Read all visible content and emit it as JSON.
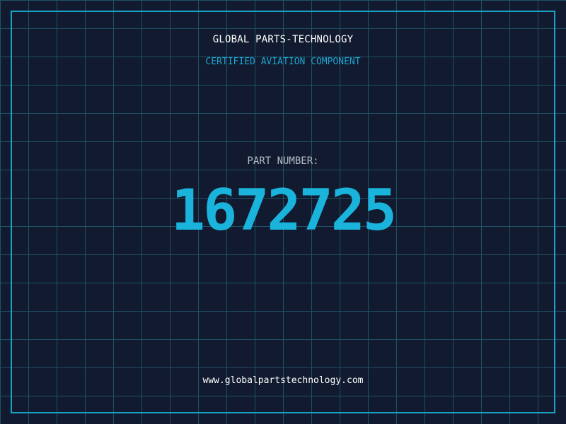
{
  "header": {
    "company": "GLOBAL PARTS-TECHNOLOGY",
    "tagline": "CERTIFIED AVIATION COMPONENT"
  },
  "part": {
    "label": "PART NUMBER:",
    "number": "1672725"
  },
  "footer": {
    "website": "www.globalpartstechnology.com"
  },
  "colors": {
    "background": "#111a2e",
    "grid": "#1f5166",
    "frame": "#1aa3c8",
    "accent": "#1ab3dc",
    "title": "#ffffff",
    "label": "#b5bcc8"
  }
}
